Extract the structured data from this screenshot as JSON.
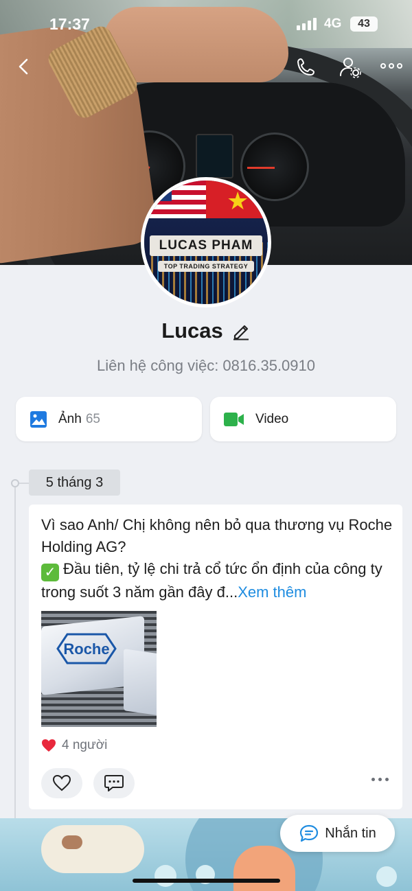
{
  "status_bar": {
    "time": "17:37",
    "network": "4G",
    "battery": "43"
  },
  "profile": {
    "name": "Lucas",
    "subtitle": "Liên hệ công việc: 0816.35.0910",
    "avatar_text": "LUCAS PHAM",
    "avatar_tagline": "TOP TRADING STRATEGY"
  },
  "media": {
    "photos_label": "Ảnh",
    "photos_count": "65",
    "video_label": "Video"
  },
  "timeline": {
    "date": "5 tháng 3",
    "post": {
      "line1": "Vì sao Anh/ Chị không nên bỏ qua thương vụ Roche Holding AG?",
      "check": "✓",
      "line2": "Đầu tiên, tỷ lệ chi trả cổ tức ổn định của công ty trong suốt 3 năm gần đây đ...",
      "more": "Xem thêm",
      "image_text": "Roche",
      "likes": "4 người"
    }
  },
  "message_button": "Nhắn tin",
  "colors": {
    "accent": "#1e8ce0",
    "photo_icon": "#1f7ae0",
    "video_icon": "#2db14b",
    "heart": "#e8283c"
  }
}
